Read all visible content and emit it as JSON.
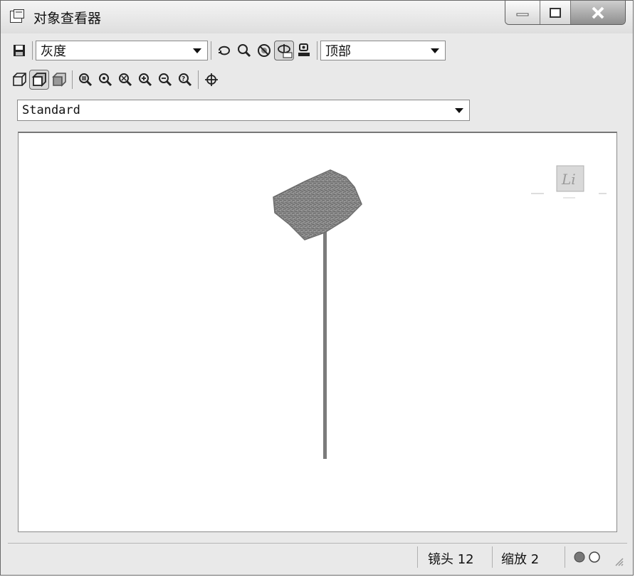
{
  "window": {
    "title": "对象查看器"
  },
  "toolbar1": {
    "visual_style": "灰度",
    "view_direction": "顶部"
  },
  "toolbar2": {},
  "render_mode": "Standard",
  "status": {
    "lens": "镜头 12",
    "zoom": "缩放 2"
  },
  "icons": {
    "save": "save-icon",
    "orbit": "orbit-icon",
    "zoom": "zoom-icon",
    "no_selection": "no-selection-icon",
    "continuous_orbit": "continuous-orbit-icon",
    "camera": "camera-icon",
    "wireframe": "wireframe-box-icon",
    "shaded": "shaded-box-icon",
    "realistic": "realistic-box-icon",
    "zoom_window": "zoom-window-icon",
    "zoom_center": "zoom-center-icon",
    "zoom_extents": "zoom-extents-icon",
    "zoom_in": "zoom-in-icon",
    "zoom_out": "zoom-out-icon",
    "zoom_help": "zoom-help-icon",
    "target": "target-icon",
    "ucs": "ucs-icon"
  },
  "colors": {
    "model": "#7b7b7b",
    "window_bg": "#e9e9e9",
    "viewport_bg": "#ffffff"
  }
}
